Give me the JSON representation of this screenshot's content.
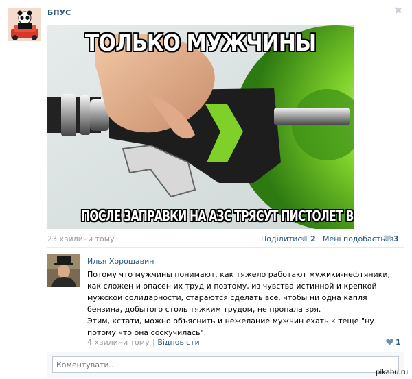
{
  "post": {
    "group_name": "БПУС",
    "close_symbol": "✖",
    "meme": {
      "top_caption": "ТОЛЬКО МУЖЧИНЫ",
      "bottom_caption": "ПОСЛЕ ЗАПРАВКИ НА АЗС ТРЯСУТ ПИСТОЛЕТ В БАКЕ"
    },
    "time": "23 хвилини тому",
    "share_label": "Поділитися",
    "share_count": "2",
    "like_label": "Мені подобається",
    "like_count": "3"
  },
  "comment": {
    "author": "Илья Хорошавин",
    "paragraphs": [
      "Потому что мужчины понимают, как тяжело работают мужики-нефтяники, как сложен и опасен их труд и поэтому, из чувства истинной и крепкой мужской солидарности, стараются сделать все, чтобы ни одна капля бензина, добытого столь тяжким трудом, не пропала зря.",
      "Этим, кстати, можно объяснить и нежелание мужчин ехать к теще \"ну потому что она соскучилась\"."
    ],
    "time": "4 хвилини тому",
    "separator": "|",
    "reply_label": "Відповісти",
    "like_count": "1"
  },
  "comment_box": {
    "placeholder": "Коментувати.."
  },
  "watermark": "pikabu.ru",
  "colors": {
    "link": "#2b587a",
    "muted": "#999999",
    "divider": "#e7eaed",
    "heart": "#b1c5d8"
  }
}
